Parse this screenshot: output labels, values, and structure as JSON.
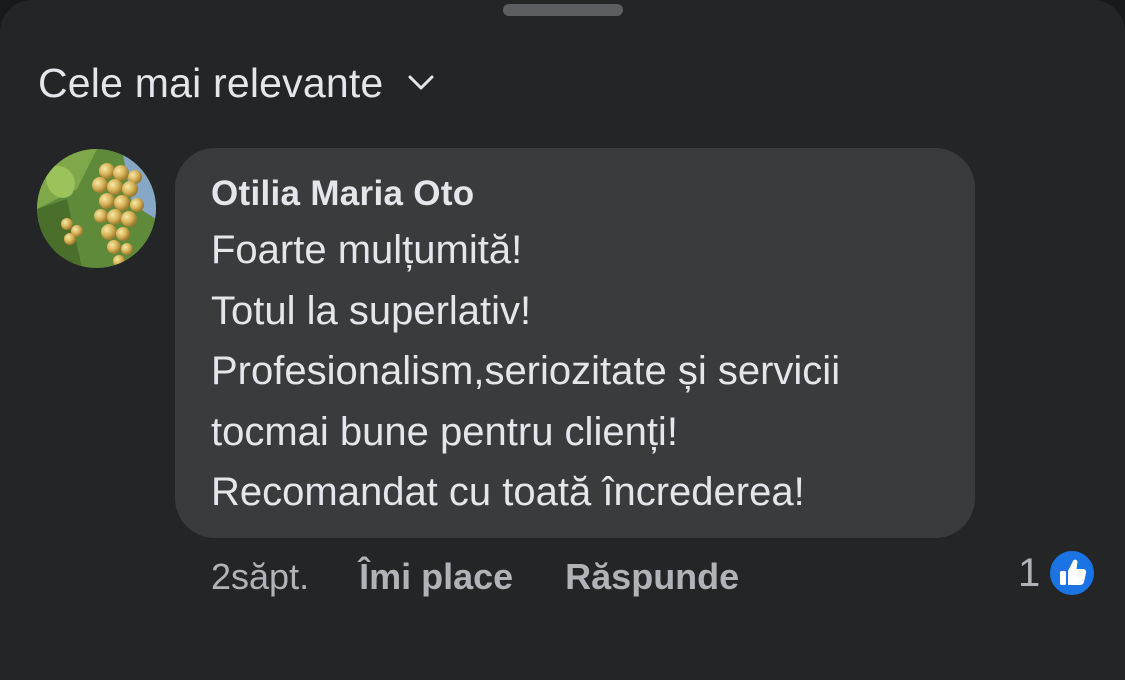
{
  "sort": {
    "label": "Cele mai relevante",
    "icon": "chevron-down-icon"
  },
  "comment": {
    "author": "Otilia Maria Oto",
    "lines": [
      "Foarte mulțumită!",
      "Totul la superlativ!",
      "Profesionalism,seriozitate și servicii",
      "tocmai bune pentru clienți!",
      "Recomandat cu toată încrederea!"
    ],
    "time": "2săpt.",
    "like_label": "Îmi place",
    "reply_label": "Răspunde",
    "reaction_count": "1",
    "reaction_icon": "thumbs-up-icon"
  },
  "colors": {
    "background": "#242526",
    "bubble": "#3a3b3c",
    "text": "#e4e6eb",
    "secondary_text": "#b0b3b8",
    "like_blue": "#1b74e4"
  }
}
